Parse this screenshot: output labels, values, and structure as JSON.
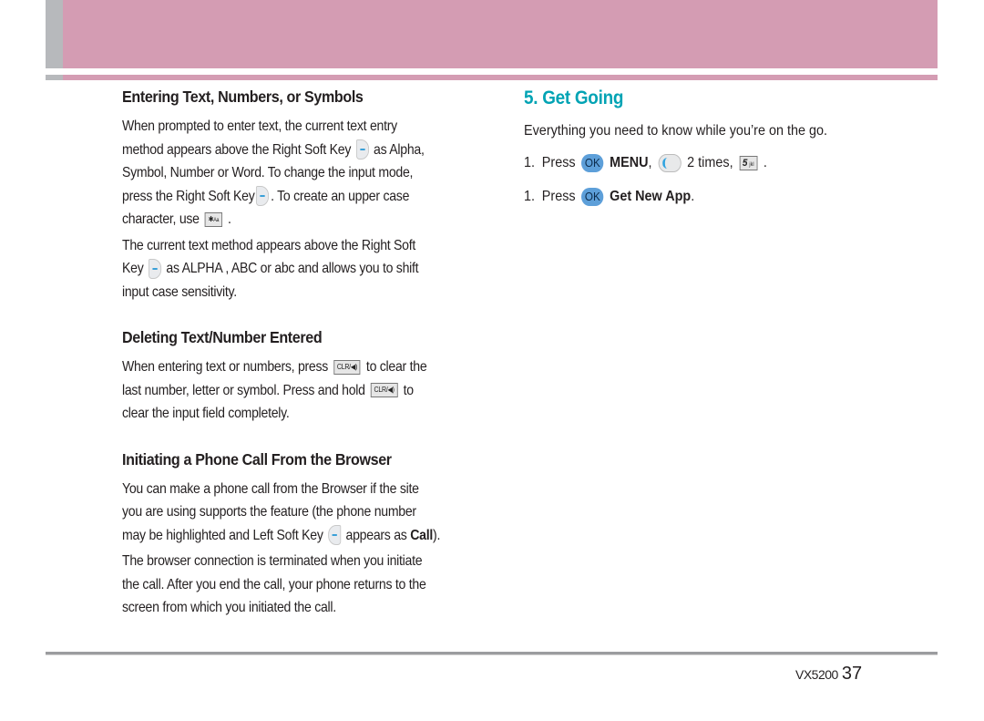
{
  "header": {
    "band_color": "#d49cb3",
    "tab_color": "#b7b9bc"
  },
  "left_column": {
    "sections": [
      {
        "heading": "Entering Text, Numbers, or Symbols",
        "paragraphs": [
          {
            "parts": [
              "When prompted to enter text, the current text entry",
              "method appears above the Right Soft Key",
              "as Alpha,",
              "Symbol, Number or Word. To change the input mode,",
              "press the Right Soft Key",
              ". To create an upper case",
              "character, use",
              "."
            ]
          },
          {
            "parts": [
              "The current text method appears above the Right Soft",
              "Key",
              "as ALPHA , ABC or abc and allows you to shift",
              "input case sensitivity."
            ]
          }
        ]
      },
      {
        "heading": "Deleting Text/Number Entered",
        "paragraphs": [
          {
            "parts": [
              "When entering text or numbers, press",
              "to clear the",
              "last number, letter or symbol. Press and hold",
              "to",
              "clear the input field completely."
            ]
          }
        ]
      },
      {
        "heading": "Initiating a Phone Call From the Browser",
        "paragraphs": [
          {
            "parts": [
              "You can make a phone call from the Browser if the site",
              "you are using supports the feature (the phone number",
              "may be highlighted and Left Soft Key",
              "appears as",
              "Call",
              ")."
            ]
          },
          {
            "parts": [
              "The browser connection is terminated when you initiate",
              "the call. After you end the call, your phone returns to the",
              "screen from which you initiated the call."
            ]
          }
        ]
      }
    ],
    "keys": {
      "star_key": "✱",
      "star_key_sub": "Aa",
      "clr_key": "CLR/◀)"
    }
  },
  "right_column": {
    "title": "5. Get Going",
    "title_color": "#00a3b4",
    "intro": "Everything you need to know while you’re on the go.",
    "steps": [
      {
        "num": "1.",
        "press": "Press",
        "ok": "OK",
        "bold": "MENU",
        "comma": ",",
        "times": "2 times,",
        "key5": "5",
        "key5_sub": "jkl",
        "end": "."
      },
      {
        "num": "1.",
        "press": "Press",
        "ok": "OK",
        "bold": "Get New App",
        "end": "."
      }
    ]
  },
  "footer": {
    "model": "VX5200",
    "page_number": "37"
  }
}
